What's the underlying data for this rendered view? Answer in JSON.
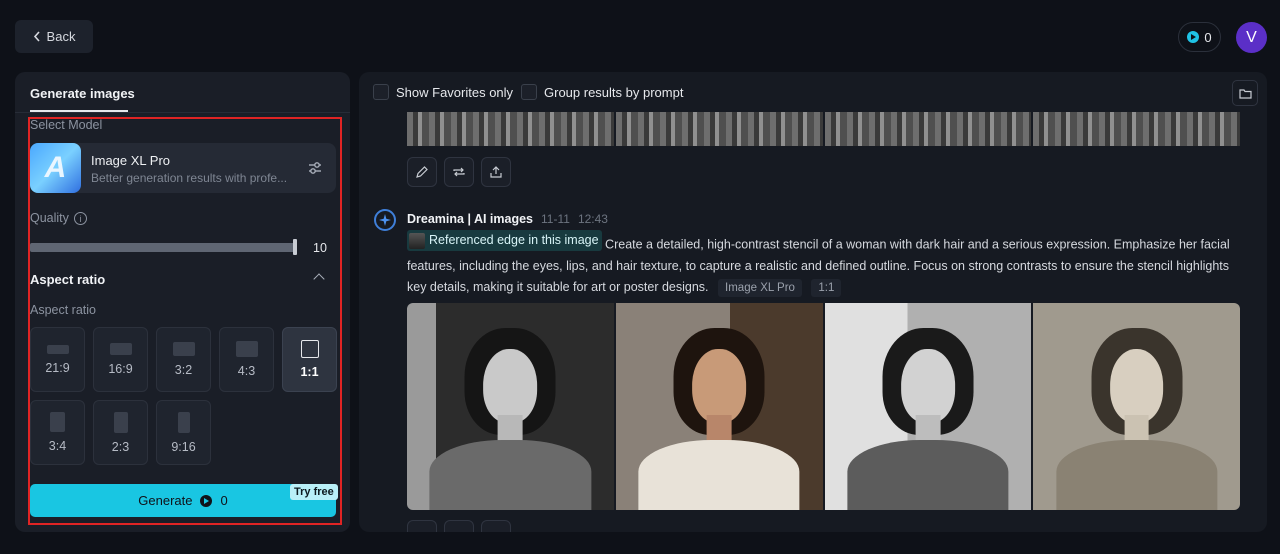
{
  "header": {
    "back_label": "Back",
    "credits": "0",
    "avatar_initial": "V"
  },
  "left_panel": {
    "tab_label": "Generate images",
    "select_model_label": "Select Model",
    "model": {
      "name": "Image XL Pro",
      "description": "Better generation results with profe...",
      "thumb_letter": "A"
    },
    "quality": {
      "label": "Quality",
      "value": 10,
      "max": 10
    },
    "aspect_section_title": "Aspect ratio",
    "aspect_label": "Aspect ratio",
    "ratios": [
      {
        "label": "21:9",
        "selected": false
      },
      {
        "label": "16:9",
        "selected": false
      },
      {
        "label": "3:2",
        "selected": false
      },
      {
        "label": "4:3",
        "selected": false
      },
      {
        "label": "1:1",
        "selected": true
      },
      {
        "label": "3:4",
        "selected": false
      },
      {
        "label": "2:3",
        "selected": false
      },
      {
        "label": "9:16",
        "selected": false
      }
    ],
    "generate_label": "Generate",
    "generate_cost": "0",
    "try_free_label": "Try free"
  },
  "right_panel": {
    "show_favorites_label": "Show Favorites only",
    "group_results_label": "Group results by prompt",
    "message": {
      "author": "Dreamina | AI images",
      "date": "11-11",
      "time": "12:43",
      "reference_label": "Referenced edge in this image",
      "prompt": "Create a detailed, high-contrast stencil of a woman with dark hair and a serious expression. Emphasize her facial features, including the eyes, lips, and hair texture, to capture a realistic and defined outline. Focus on strong contrasts to ensure the stencil highlights key details, making it suitable for art or poster designs.",
      "model_tag": "Image XL Pro",
      "ratio_tag": "1:1"
    }
  },
  "colors": {
    "accent": "#19c6e2",
    "avatar": "#5b2fc7",
    "highlight_frame": "#e02424"
  }
}
